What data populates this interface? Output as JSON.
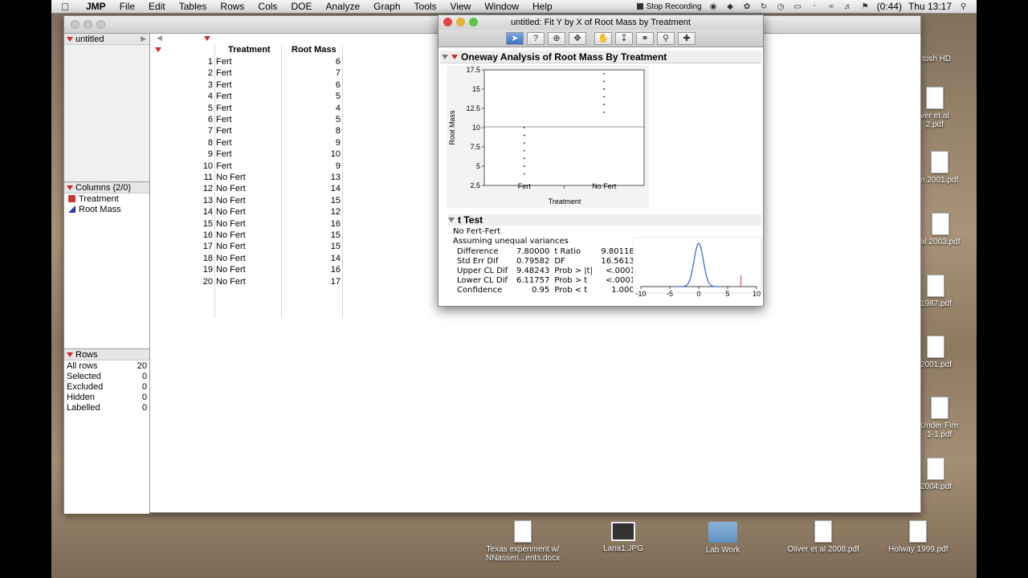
{
  "menubar": {
    "app": "JMP",
    "items": [
      "File",
      "Edit",
      "Tables",
      "Rows",
      "Cols",
      "DOE",
      "Analyze",
      "Graph",
      "Tools",
      "View",
      "Window",
      "Help"
    ],
    "stop_recording": "Stop Recording",
    "battery": "(0:44)",
    "clock": "Thu 13:17"
  },
  "desktop": {
    "right_icons": [
      "tosh HD",
      "ver et al\n2.pdf",
      "n 2001.pdf",
      "al 2003.pdf",
      "1987.pdf",
      "2001.pdf",
      "Under Fire\n1-1.pdf",
      "2004.pdf",
      "Holway 1999.pdf"
    ],
    "bottom_icons": [
      "Texas experiment w/\nNNasseri...ents.docx",
      "Lana1.JPG",
      "Lab Work",
      "Oliver et al 2008.pdf"
    ]
  },
  "left_panel": {
    "table_name": "untitled",
    "columns_header": "Columns (2/0)",
    "columns": [
      "Treatment",
      "Root Mass"
    ],
    "rows_header": "Rows",
    "rows_stats": [
      {
        "label": "All rows",
        "value": "20"
      },
      {
        "label": "Selected",
        "value": "0"
      },
      {
        "label": "Excluded",
        "value": "0"
      },
      {
        "label": "Hidden",
        "value": "0"
      },
      {
        "label": "Labelled",
        "value": "0"
      }
    ]
  },
  "grid": {
    "headers": {
      "treatment": "Treatment",
      "root_mass": "Root Mass"
    },
    "rows": [
      {
        "n": "1",
        "t": "Fert",
        "m": "6"
      },
      {
        "n": "2",
        "t": "Fert",
        "m": "7"
      },
      {
        "n": "3",
        "t": "Fert",
        "m": "6"
      },
      {
        "n": "4",
        "t": "Fert",
        "m": "5"
      },
      {
        "n": "5",
        "t": "Fert",
        "m": "4"
      },
      {
        "n": "6",
        "t": "Fert",
        "m": "5"
      },
      {
        "n": "7",
        "t": "Fert",
        "m": "8"
      },
      {
        "n": "8",
        "t": "Fert",
        "m": "9"
      },
      {
        "n": "9",
        "t": "Fert",
        "m": "10"
      },
      {
        "n": "10",
        "t": "Fert",
        "m": "9"
      },
      {
        "n": "11",
        "t": "No Fert",
        "m": "13"
      },
      {
        "n": "12",
        "t": "No Fert",
        "m": "14"
      },
      {
        "n": "13",
        "t": "No Fert",
        "m": "15"
      },
      {
        "n": "14",
        "t": "No Fert",
        "m": "12"
      },
      {
        "n": "15",
        "t": "No Fert",
        "m": "16"
      },
      {
        "n": "16",
        "t": "No Fert",
        "m": "15"
      },
      {
        "n": "17",
        "t": "No Fert",
        "m": "15"
      },
      {
        "n": "18",
        "t": "No Fert",
        "m": "14"
      },
      {
        "n": "19",
        "t": "No Fert",
        "m": "16"
      },
      {
        "n": "20",
        "t": "No Fert",
        "m": "17"
      }
    ]
  },
  "analysis": {
    "window_title": "untitled: Fit Y by X of Root Mass by Treatment",
    "oneway_header": "Oneway Analysis of Root Mass By Treatment",
    "ttest_header": "t Test",
    "comparison": "No Fert-Fert",
    "assumption": "Assuming unequal variances",
    "stats": [
      {
        "label": "Difference",
        "value": "7.80000",
        "label2": "t Ratio",
        "value2": "9.801181"
      },
      {
        "label": "Std Err Dif",
        "value": "0.79582",
        "label2": "DF",
        "value2": "16.56132"
      },
      {
        "label": "Upper CL Dif",
        "value": "9.48243",
        "label2": "Prob > |t|",
        "value2": "<.0001*"
      },
      {
        "label": "Lower CL Dif",
        "value": "6.11757",
        "label2": "Prob > t",
        "value2": "<.0001*"
      },
      {
        "label": "Confidence",
        "value": "0.95",
        "label2": "Prob < t",
        "value2": "1.0000"
      }
    ]
  },
  "chart_data": [
    {
      "type": "scatter",
      "xlabel": "Treatment",
      "ylabel": "Root Mass",
      "categories": [
        "Fert",
        "No Fert"
      ],
      "yticks": [
        "2.5",
        "5",
        "7.5",
        "10",
        "12.5",
        "15",
        "17.5"
      ],
      "ylim": [
        2.5,
        17.5
      ],
      "grand_mean": 10.1,
      "series": [
        {
          "category": "Fert",
          "values": [
            6,
            7,
            6,
            5,
            4,
            5,
            8,
            9,
            10,
            9
          ]
        },
        {
          "category": "No Fert",
          "values": [
            13,
            14,
            15,
            12,
            16,
            15,
            15,
            14,
            16,
            17
          ]
        }
      ]
    },
    {
      "type": "line",
      "xticks": [
        "-10",
        "-5",
        "0",
        "5",
        "10"
      ],
      "xlim": [
        -10,
        10
      ],
      "t_ratio": 9.801181,
      "colors": {
        "curve": "#3b6fd4",
        "marker": "#d23b3b"
      }
    }
  ]
}
